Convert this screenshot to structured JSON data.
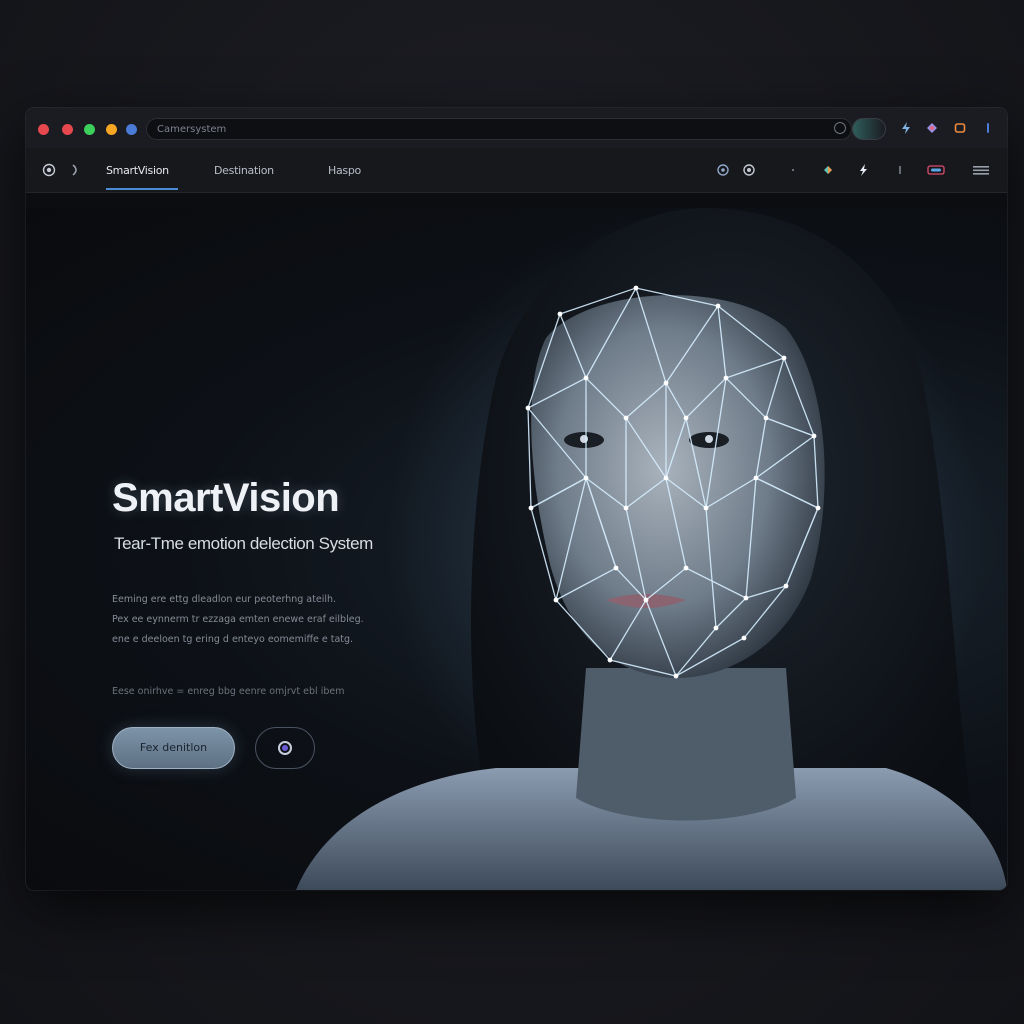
{
  "browser": {
    "url": "Camersystem",
    "traffic_dot_colors": [
      "#e5484d",
      "#e5484d",
      "#3ccf5b",
      "#f5a623",
      "#4a7bd6"
    ]
  },
  "nav": {
    "links": [
      "SmartVision",
      "Destination",
      "Haspo"
    ],
    "active_index": 0
  },
  "hero": {
    "title": "SmartVision",
    "subtitle": "Tear-Tme emotion delection System",
    "description_lines": [
      "Eeming ere ettg dleadlon eur peoterhng ateilh.",
      "Pex ee eynnerm tr ezzaga emten enewe eraf eilbleg.",
      "ene e deeloen tg ering d enteyo eomemiffe e tatg."
    ],
    "note": "Eese onirhve  =  enreg bbg eenre omjrvt ebl ibem",
    "cta_label": "Fex denitlon",
    "play_icon": "record-icon"
  },
  "colors": {
    "accent": "#4a8dd6",
    "mesh": "#cfe9ff",
    "cta": "#7d93a8"
  }
}
